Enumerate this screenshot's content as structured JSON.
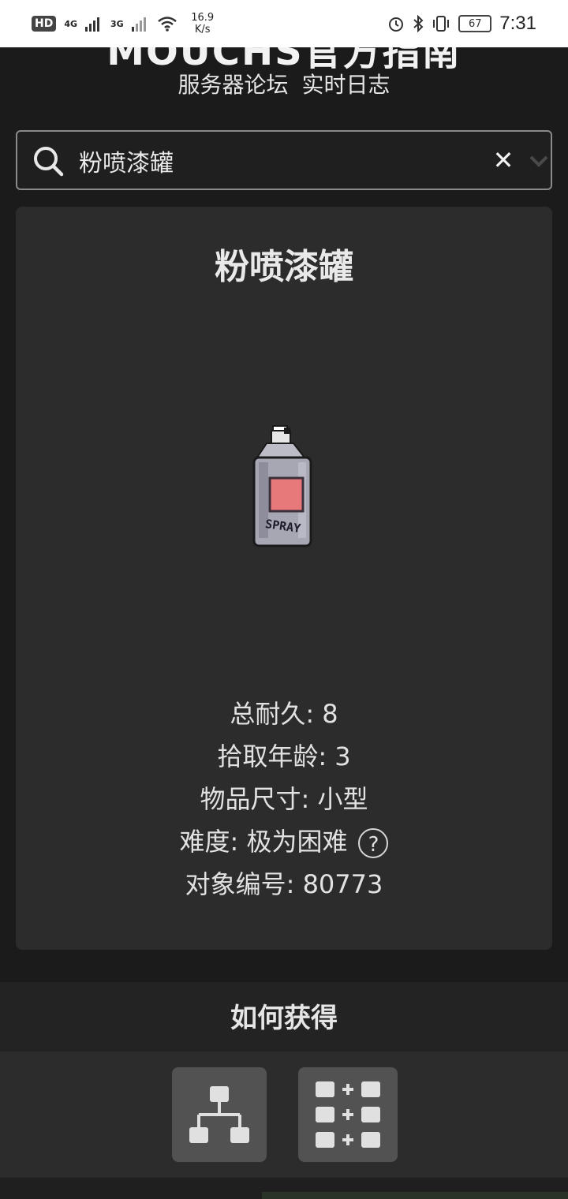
{
  "status_bar": {
    "hd": "HD",
    "network_1": "4G",
    "network_2": "3G",
    "speed_value": "16.9",
    "speed_unit": "K/s",
    "battery": "67",
    "time": "7:31"
  },
  "header": {
    "site_title": "MOUCHS官方指南",
    "links": [
      "服务器论坛",
      "实时日志"
    ]
  },
  "search": {
    "value": "粉喷漆罐",
    "clear_label": "✕",
    "icons": [
      "search-icon",
      "close-icon",
      "chevron-down-icon"
    ]
  },
  "item": {
    "name": "粉喷漆罐",
    "image_icon": "spray-can-icon",
    "can_label": "SPRAY",
    "label_color": "#e8797a",
    "stats": [
      {
        "label": "总耐久: 8"
      },
      {
        "label": "拾取年龄: 3"
      },
      {
        "label": "物品尺寸: 小型"
      },
      {
        "label": "难度: 极为困难"
      },
      {
        "label": "对象编号: 80773"
      }
    ],
    "help_label": "?"
  },
  "obtain": {
    "title": "如何获得",
    "buttons": [
      {
        "icon": "tech-tree-icon"
      },
      {
        "icon": "recipe-grid-icon"
      }
    ]
  },
  "colors": {
    "background": "#1b1b1b",
    "card": "#2c2c2c",
    "button": "#525252"
  }
}
